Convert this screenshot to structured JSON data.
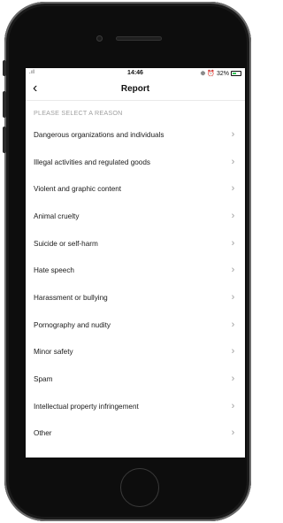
{
  "status": {
    "signal": ".ıl",
    "time": "14:46",
    "right": "⊕ ⏰ 32%"
  },
  "header": {
    "back_icon": "‹",
    "title": "Report"
  },
  "section_label": "PLEASE SELECT A REASON",
  "reasons": [
    "Dangerous organizations and individuals",
    "Illegal activities and regulated goods",
    "Violent and graphic content",
    "Animal cruelty",
    "Suicide or self-harm",
    "Hate speech",
    "Harassment or bullying",
    "Pornography and nudity",
    "Minor safety",
    "Spam",
    "Intellectual property infringement",
    "Other"
  ],
  "colors": {
    "text": "#1a1a1a",
    "secondary_text": "#a0a0a0",
    "chevron": "#9b9b9b",
    "battery_charging": "#34c759"
  },
  "icons": {
    "back": "chevron-left-icon",
    "row": "chevron-right-icon"
  }
}
